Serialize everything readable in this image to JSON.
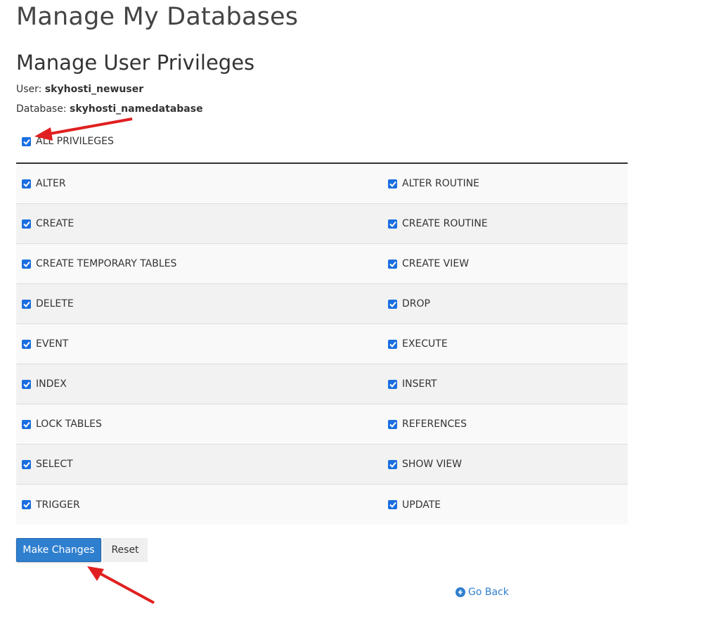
{
  "header": {
    "title": "Manage My Databases",
    "section_title": "Manage User Privileges"
  },
  "info": {
    "user_label": "User:",
    "user_value": "skyhosti_newuser",
    "database_label": "Database:",
    "database_value": "skyhosti_namedatabase"
  },
  "all_privileges": {
    "label": "ALL PRIVILEGES",
    "checked": true
  },
  "privileges": [
    {
      "left": "ALTER",
      "right": "ALTER ROUTINE"
    },
    {
      "left": "CREATE",
      "right": "CREATE ROUTINE"
    },
    {
      "left": "CREATE TEMPORARY TABLES",
      "right": "CREATE VIEW"
    },
    {
      "left": "DELETE",
      "right": "DROP"
    },
    {
      "left": "EVENT",
      "right": "EXECUTE"
    },
    {
      "left": "INDEX",
      "right": "INSERT"
    },
    {
      "left": "LOCK TABLES",
      "right": "REFERENCES"
    },
    {
      "left": "SELECT",
      "right": "SHOW VIEW"
    },
    {
      "left": "TRIGGER",
      "right": "UPDATE"
    }
  ],
  "actions": {
    "make_changes": "Make Changes",
    "reset": "Reset",
    "go_back": "Go Back"
  },
  "colors": {
    "accent": "#2f7fcf",
    "checkbox": "#1a6ee0",
    "annotation_arrow": "#e02020"
  },
  "icons": {
    "checkbox": "checkmark-icon",
    "go_back": "arrow-left-circle-icon"
  }
}
